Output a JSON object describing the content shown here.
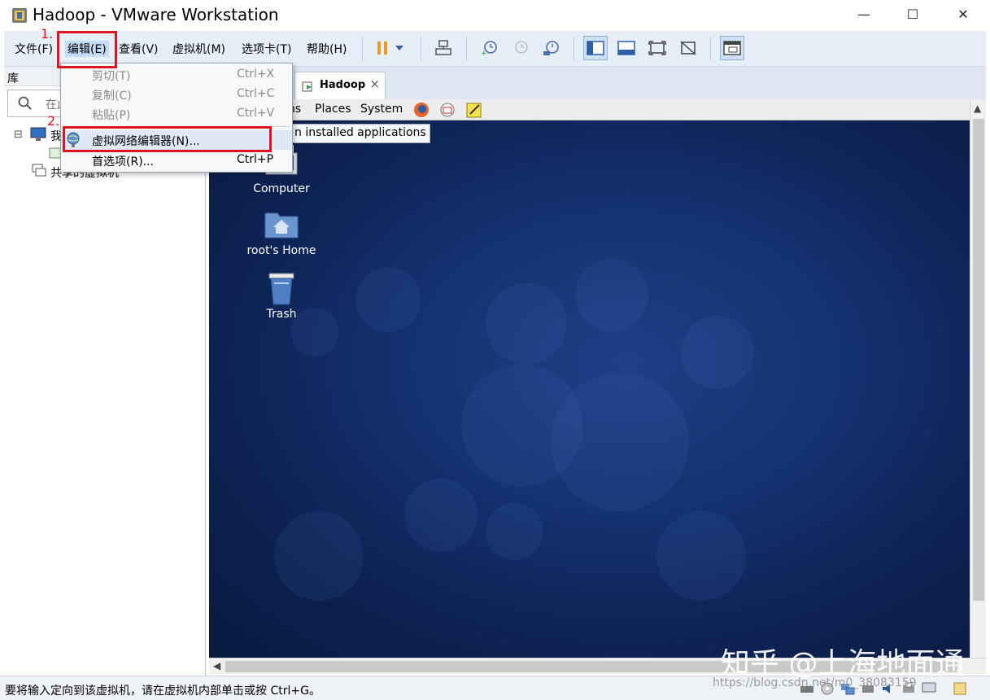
{
  "window": {
    "title": "Hadoop - VMware Workstation",
    "minimize": "—",
    "maximize": "☐",
    "close": "✕"
  },
  "menubar": {
    "items": [
      "文件(F)",
      "编辑(E)",
      "查看(V)",
      "虚拟机(M)",
      "选项卡(T)",
      "帮助(H)"
    ]
  },
  "annotations": {
    "step1": "1.",
    "step2": "2."
  },
  "edit_menu": {
    "items": [
      {
        "label": "剪切(T)",
        "shortcut": "Ctrl+X",
        "disabled": true
      },
      {
        "label": "复制(C)",
        "shortcut": "Ctrl+C",
        "disabled": true
      },
      {
        "label": "粘贴(P)",
        "shortcut": "Ctrl+V",
        "disabled": true
      },
      {
        "label": "虚拟网络编辑器(N)...",
        "shortcut": "",
        "disabled": false,
        "highlighted": true
      },
      {
        "label": "首选项(R)...",
        "shortcut": "Ctrl+P",
        "disabled": false
      }
    ]
  },
  "library": {
    "header": "库",
    "search_placeholder": "在此",
    "tree": [
      {
        "label": "我"
      },
      {
        "label": "共享的虚拟机"
      }
    ]
  },
  "tabs": [
    {
      "label": "Hadoop",
      "close": "×"
    }
  ],
  "guest": {
    "panel": {
      "items": [
        "ns",
        "Places",
        "System"
      ]
    },
    "tooltip": "n installed applications",
    "desktop_icons": [
      {
        "label": "Computer",
        "icon": "computer-icon"
      },
      {
        "label": "root's Home",
        "icon": "home-folder-icon"
      },
      {
        "label": "Trash",
        "icon": "trash-icon"
      }
    ]
  },
  "statusbar": {
    "text": "要将输入定向到该虚拟机，请在虚拟机内部单击或按 Ctrl+G。"
  },
  "watermark": {
    "text": "知乎 @上海地面通",
    "url": "https://blog.csdn.net/m0_38083159"
  },
  "colors": {
    "annotation_red": "#e0141e",
    "menubar_bg": "#e6eef8",
    "desktop_blue": "#153272"
  }
}
